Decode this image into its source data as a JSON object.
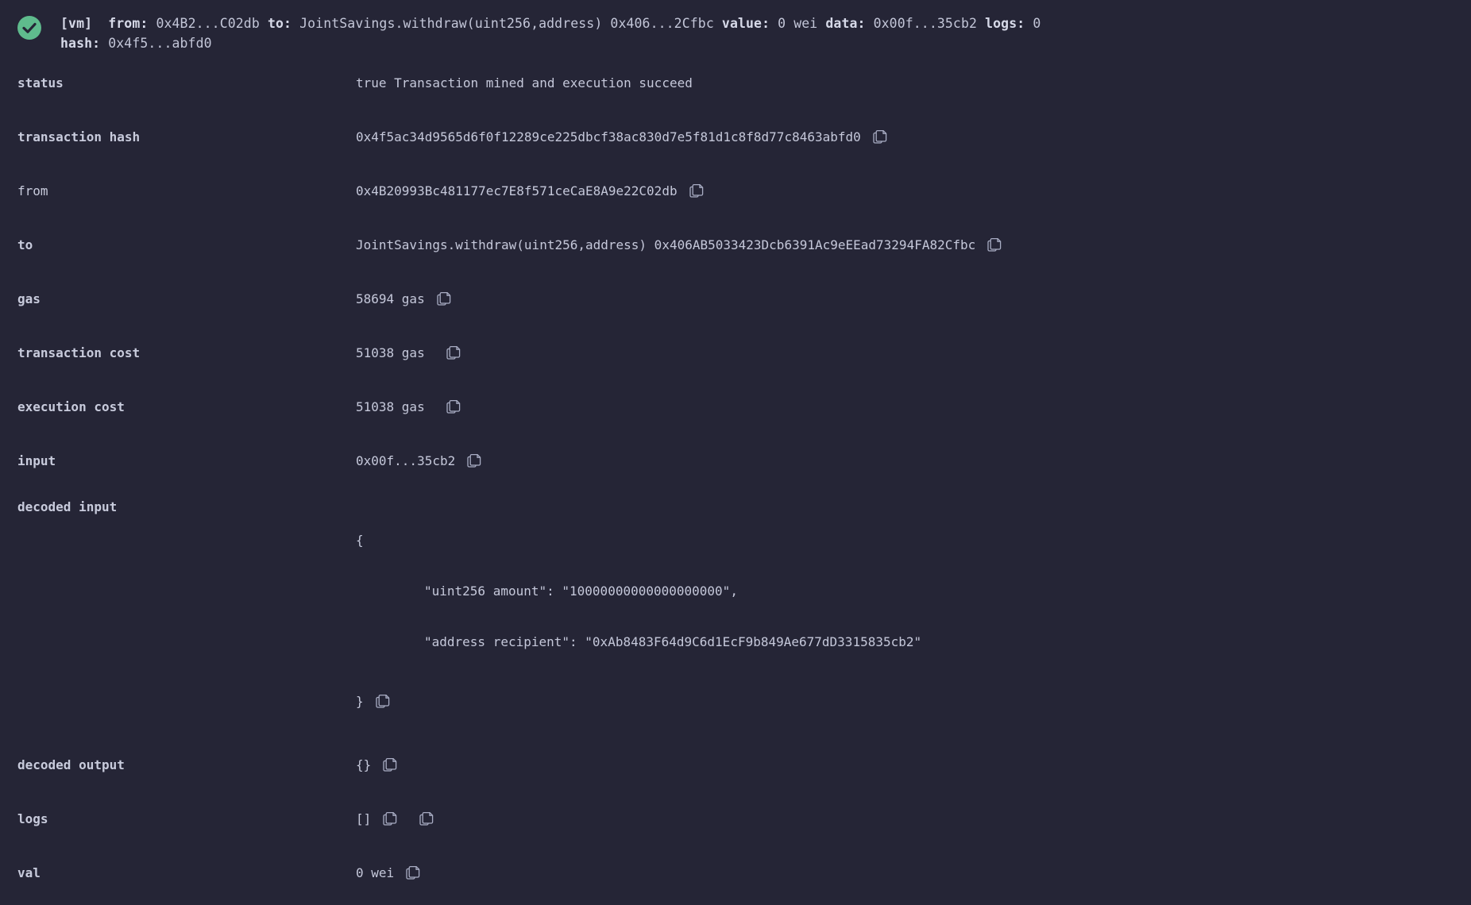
{
  "header": {
    "status_icon": "success-check-icon",
    "accent_color": "#5fbb8d",
    "background_color": "#252536",
    "line1_prefix": "[vm]",
    "line1_from_label": "from:",
    "line1_from_value": "0x4B2...C02db",
    "line1_to_label": "to:",
    "line1_to_value": "JointSavings.withdraw(uint256,address) 0x406...2Cfbc",
    "line1_value_label": "value:",
    "line1_value_value": "0 wei",
    "line1_data_label": "data:",
    "line1_data_value": "0x00f...35cb2",
    "line1_logs_label": "logs:",
    "line1_logs_value": "0",
    "line2_hash_label": "hash:",
    "line2_hash_value": "0x4f5...abfd0"
  },
  "rows": {
    "status": {
      "label": "status",
      "value": "true Transaction mined and execution succeed"
    },
    "transaction_hash": {
      "label": "transaction hash",
      "value": "0x4f5ac34d9565d6f0f12289ce225dbcf38ac830d7e5f81d1c8f8d77c8463abfd0"
    },
    "from": {
      "label": "from",
      "value": "0x4B20993Bc481177ec7E8f571ceCaE8A9e22C02db"
    },
    "to": {
      "label": "to",
      "value": "JointSavings.withdraw(uint256,address) 0x406AB5033423Dcb6391Ac9eEEad73294FA82Cfbc"
    },
    "gas": {
      "label": "gas",
      "value": "58694 gas"
    },
    "transaction_cost": {
      "label": "transaction cost",
      "value": "51038 gas"
    },
    "execution_cost": {
      "label": "execution cost",
      "value": "51038 gas"
    },
    "input": {
      "label": "input",
      "value": "0x00f...35cb2"
    },
    "decoded_input": {
      "label": "decoded input",
      "open_brace": "{",
      "line_amount": "\"uint256 amount\": \"10000000000000000000\",",
      "line_recipient": "\"address recipient\": \"0xAb8483F64d9C6d1EcF9b849Ae677dD3315835cb2\"",
      "close_brace": "}"
    },
    "decoded_output": {
      "label": "decoded output",
      "value": "{}"
    },
    "logs": {
      "label": "logs",
      "value": "[]"
    },
    "val": {
      "label": "val",
      "value": "0 wei"
    }
  },
  "icons": {
    "copy": "copy-icon",
    "copy_logs_secondary": "copy-raw-logs-icon"
  }
}
